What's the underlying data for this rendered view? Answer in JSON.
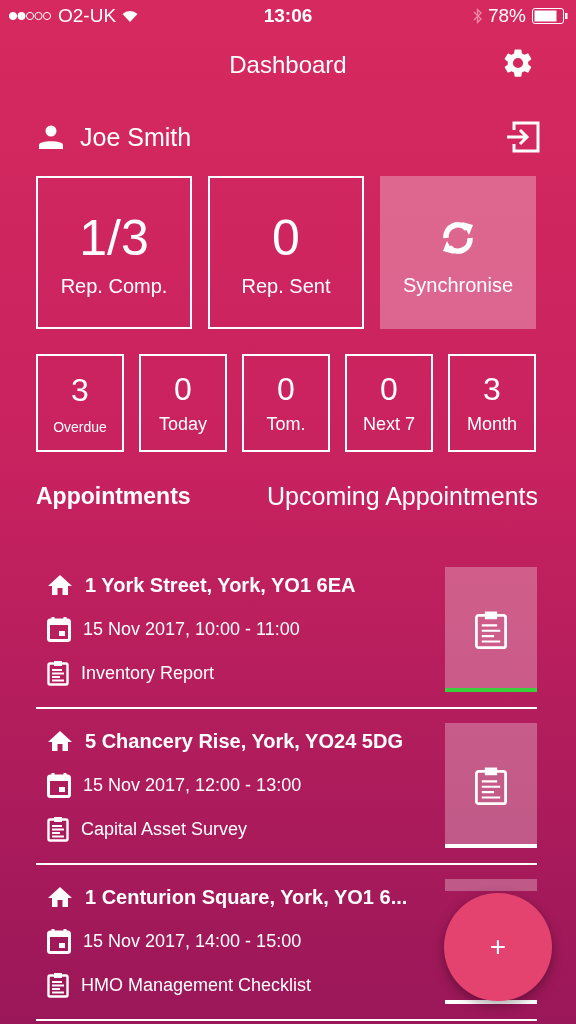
{
  "status_bar": {
    "carrier": "O2-UK",
    "time": "13:06",
    "battery": "78%"
  },
  "header": {
    "title": "Dashboard"
  },
  "user": {
    "name": "Joe Smith"
  },
  "stats": [
    {
      "value": "1/3",
      "label": "Rep. Comp."
    },
    {
      "value": "0",
      "label": "Rep. Sent"
    }
  ],
  "sync_button": {
    "label": "Synchronise"
  },
  "counters": [
    {
      "value": "3",
      "label": "Overdue",
      "kind": "small"
    },
    {
      "value": "0",
      "label": "Today",
      "kind": "normal"
    },
    {
      "value": "0",
      "label": "Tom.",
      "kind": "normal"
    },
    {
      "value": "0",
      "label": "Next 7",
      "kind": "normal"
    },
    {
      "value": "3",
      "label": "Month",
      "kind": "normal"
    }
  ],
  "tabs": [
    {
      "label": "Appointments",
      "selected": true
    },
    {
      "label": "Upcoming Appointments",
      "selected": false
    }
  ],
  "appointments": [
    {
      "address": "1 York Street, York, YO1 6EA",
      "time": "15 Nov 2017, 10:00 - 11:00",
      "report": "Inventory Report",
      "color": "#3ccf3c",
      "covered": false
    },
    {
      "address": "5 Chancery Rise, York, YO24 5DG",
      "time": "15 Nov 2017, 12:00 - 13:00",
      "report": "Capital Asset Survey",
      "color": "#ffffff",
      "covered": false
    },
    {
      "address": "1 Centurion Square, York, YO1 6...",
      "time": "15 Nov 2017, 14:00 - 15:00",
      "report": "HMO Management Checklist",
      "color": "#ffffff",
      "covered": true
    }
  ],
  "fab": {
    "label": "+"
  }
}
